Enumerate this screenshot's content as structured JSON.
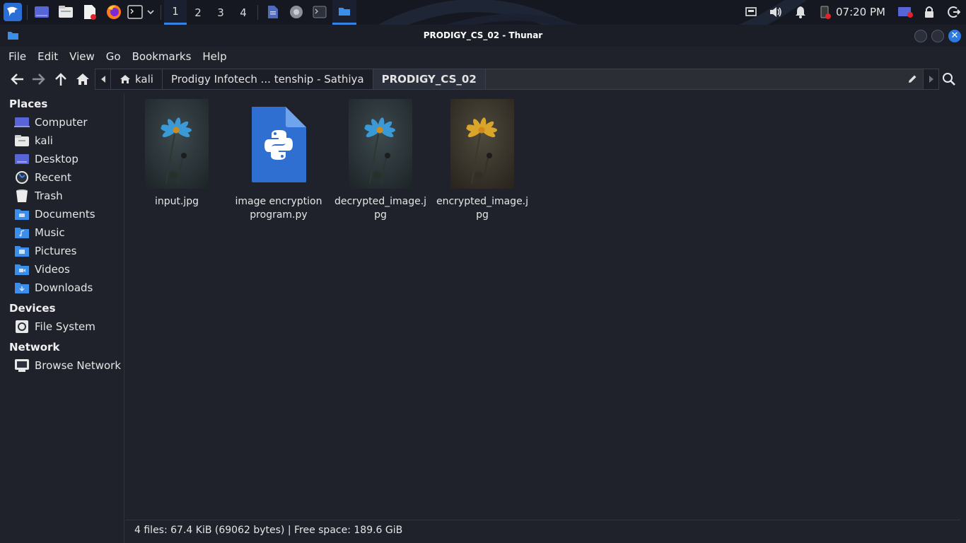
{
  "panel": {
    "workspaces": [
      "1",
      "2",
      "3",
      "4"
    ],
    "active_workspace": "1",
    "launchers": [
      "kali-menu-icon",
      "desktop-icon",
      "file-manager-icon",
      "text-editor-icon",
      "firefox-icon",
      "terminal-icon"
    ],
    "clock": "07:20 PM"
  },
  "window": {
    "title": "PRODIGY_CS_02 - Thunar"
  },
  "menubar": {
    "items": [
      "File",
      "Edit",
      "View",
      "Go",
      "Bookmarks",
      "Help"
    ]
  },
  "pathbar": {
    "crumbs": [
      "kali",
      "Prodigy Infotech ... tenship - Sathiya",
      "PRODIGY_CS_02"
    ]
  },
  "sidebar": {
    "places_header": "Places",
    "places": [
      {
        "label": "Computer",
        "icon": "computer-icon"
      },
      {
        "label": "kali",
        "icon": "home-folder-icon"
      },
      {
        "label": "Desktop",
        "icon": "desktop-icon"
      },
      {
        "label": "Recent",
        "icon": "recent-icon"
      },
      {
        "label": "Trash",
        "icon": "trash-icon"
      },
      {
        "label": "Documents",
        "icon": "documents-folder-icon"
      },
      {
        "label": "Music",
        "icon": "music-folder-icon"
      },
      {
        "label": "Pictures",
        "icon": "pictures-folder-icon"
      },
      {
        "label": "Videos",
        "icon": "videos-folder-icon"
      },
      {
        "label": "Downloads",
        "icon": "downloads-folder-icon"
      }
    ],
    "devices_header": "Devices",
    "devices": [
      {
        "label": "File System",
        "icon": "drive-icon"
      }
    ],
    "network_header": "Network",
    "network": [
      {
        "label": "Browse Network",
        "icon": "network-icon"
      }
    ]
  },
  "files": [
    {
      "name": "input.jpg",
      "kind": "image",
      "flower_color": "#3a9ad6"
    },
    {
      "name": "image encryption program.py",
      "kind": "python"
    },
    {
      "name": "decrypted_image.jpg",
      "kind": "image",
      "flower_color": "#3a9ad6"
    },
    {
      "name": "encrypted_image.jpg",
      "kind": "image",
      "flower_color": "#d9a52a"
    }
  ],
  "status": {
    "text": "4 files: 67.4 KiB (69062 bytes)  |  Free space: 189.6 GiB"
  },
  "colors": {
    "accent": "#3584e4",
    "background": "#1f222b",
    "panel": "#151820"
  }
}
